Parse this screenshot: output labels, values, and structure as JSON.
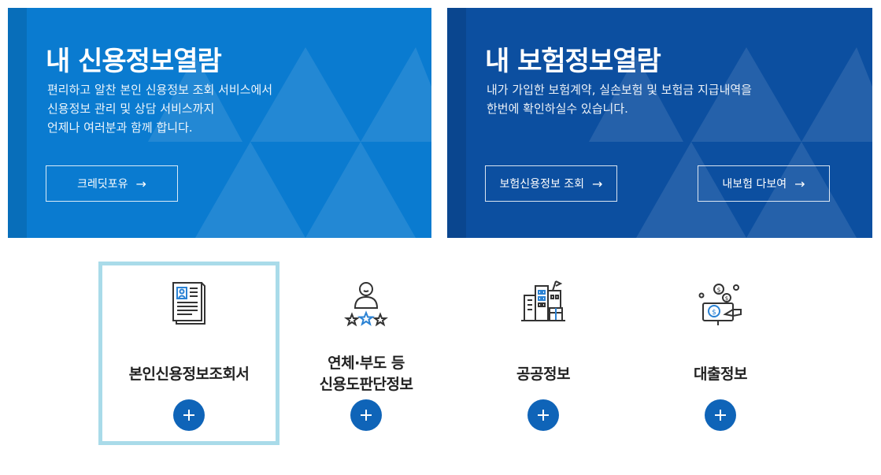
{
  "banners": {
    "credit": {
      "title": "내 신용정보열람",
      "desc": [
        "편리하고 알찬 본인 신용정보 조회 서비스에서",
        "신용정보 관리 및 상담 서비스까지",
        "언제나 여러분과 함께 합니다."
      ],
      "button": "크레딧포유",
      "color": "#0a7bd0"
    },
    "insurance": {
      "title": "내 보험정보열람",
      "desc": [
        "내가 가입한 보험계약, 실손보험 및 보험금 지급내역을",
        "한번에 확인하실수 있습니다."
      ],
      "button1": "보험신용정보 조회",
      "button2": "내보험 다보여",
      "color": "#0c4fa0"
    }
  },
  "cards": [
    {
      "title_lines": [
        "본인신용정보조회서"
      ],
      "icon": "document-profile-icon",
      "active": true
    },
    {
      "title_lines": [
        "연체·부도 등",
        "신용도판단정보"
      ],
      "icon": "person-rating-icon",
      "active": false
    },
    {
      "title_lines": [
        "공공정보"
      ],
      "icon": "buildings-icon",
      "active": false
    },
    {
      "title_lines": [
        "대출정보"
      ],
      "icon": "loan-money-icon",
      "active": false
    }
  ],
  "colors": {
    "plus_button": "#0f64b8",
    "active_border": "#a9dbe9",
    "icon_accent": "#2a82d4"
  }
}
